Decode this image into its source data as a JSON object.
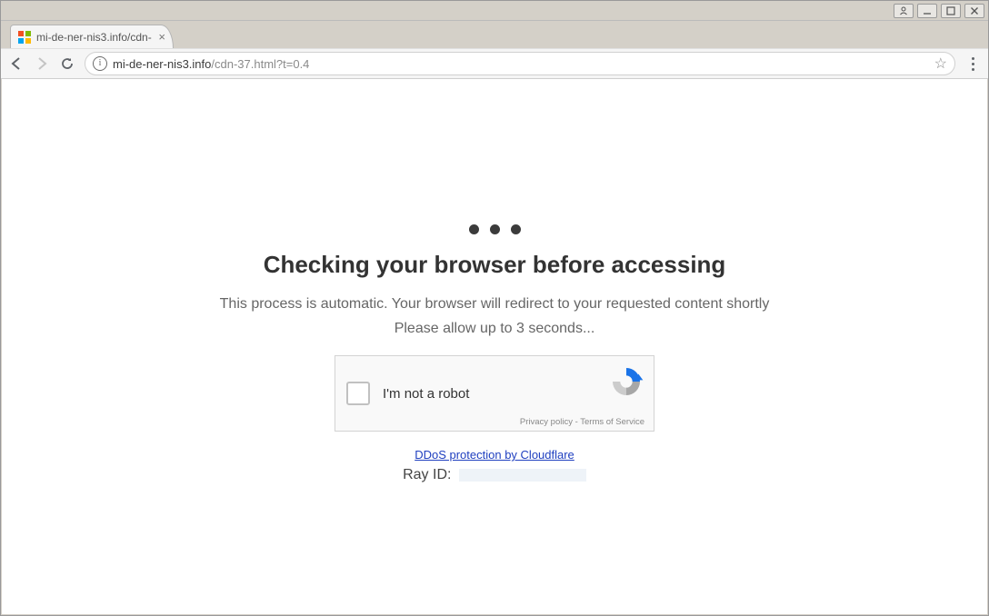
{
  "window": {
    "tab_title": "mi-de-ner-nis3.info/cdn-",
    "url_host": "mi-de-ner-nis3.info",
    "url_path": "/cdn-37.html?t=0.4"
  },
  "page": {
    "heading": "Checking your browser before accessing",
    "line1": "This process is automatic. Your browser will redirect to your requested content shortly",
    "line2": "Please allow up to 3 seconds...",
    "ddos_link": "DDoS protection by Cloudflare",
    "ray_label": "Ray ID:"
  },
  "recaptcha": {
    "label": "I'm not a robot",
    "privacy": "Privacy policy",
    "sep": " - ",
    "terms": "Terms of Service"
  }
}
